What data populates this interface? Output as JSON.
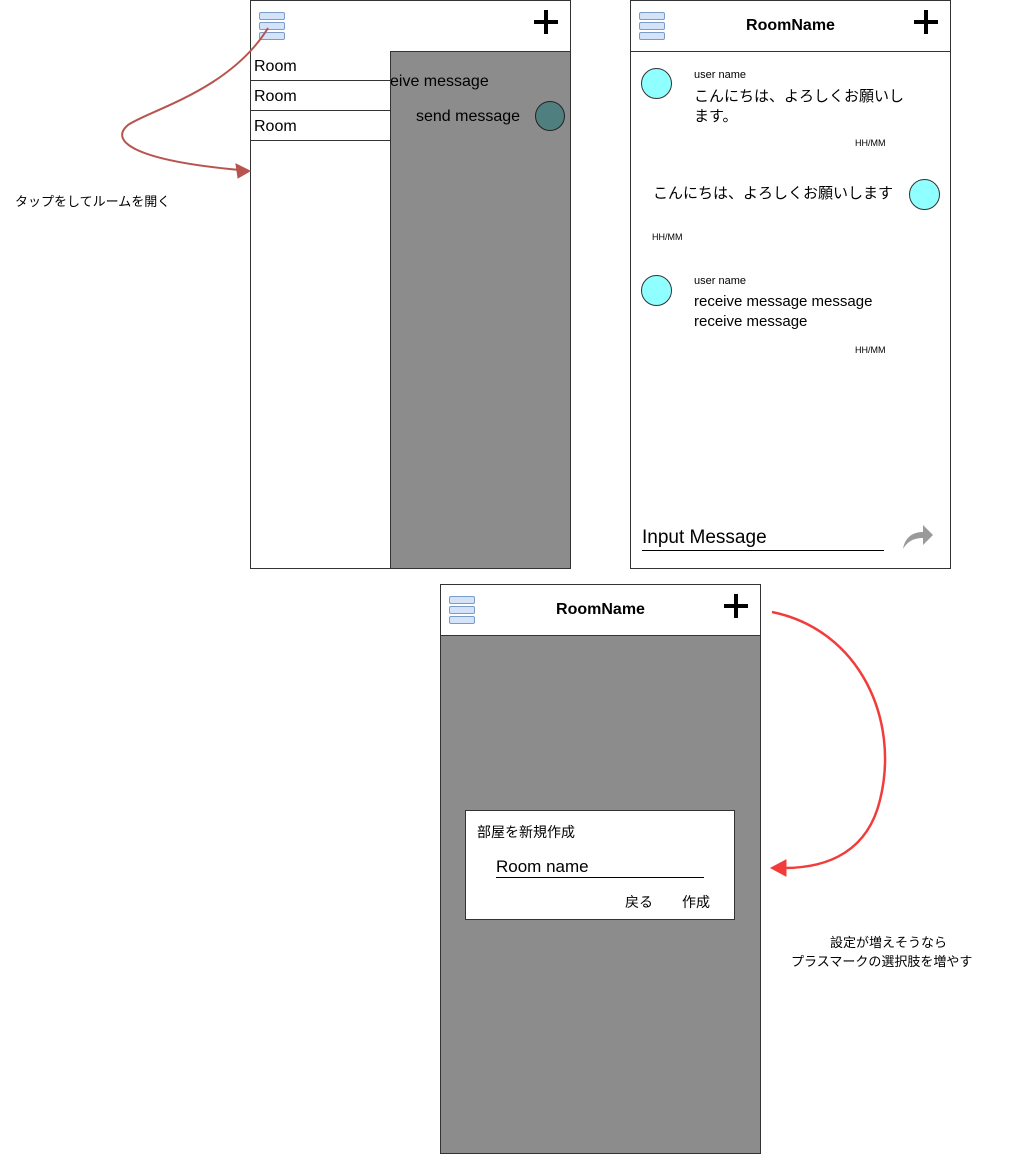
{
  "phone1": {
    "rooms": [
      "Room",
      "Room",
      "Room"
    ],
    "receive_fragment": "eive message",
    "send_message": "send message"
  },
  "phone2": {
    "title": "RoomName",
    "messages": [
      {
        "user": "user name",
        "text": "こんにちは、よろしくお願いします。",
        "time": "HH/MM"
      },
      {
        "text": "こんにちは、よろしくお願いします",
        "time": "HH/MM"
      },
      {
        "user": "user name",
        "text": "receive message message receive message",
        "time": "HH/MM"
      }
    ],
    "input_label": "Input Message"
  },
  "phone3": {
    "title": "RoomName",
    "dialog": {
      "title": "部屋を新規作成",
      "input_label": "Room name",
      "back": "戻る",
      "create": "作成"
    }
  },
  "annotations": {
    "tap_room": "タップをしてルームを開く",
    "plus_line1": "設定が増えそうなら",
    "plus_line2": "プラスマークの選択肢を増やす"
  },
  "colors": {
    "arrow_left": "#b85450",
    "arrow_right": "#f23c3c",
    "avatar": "#8fffff",
    "overlay": "#8c8c8c"
  },
  "icons": {
    "menu": "hamburger-icon",
    "add": "plus-icon",
    "send": "share-arrow-icon"
  }
}
